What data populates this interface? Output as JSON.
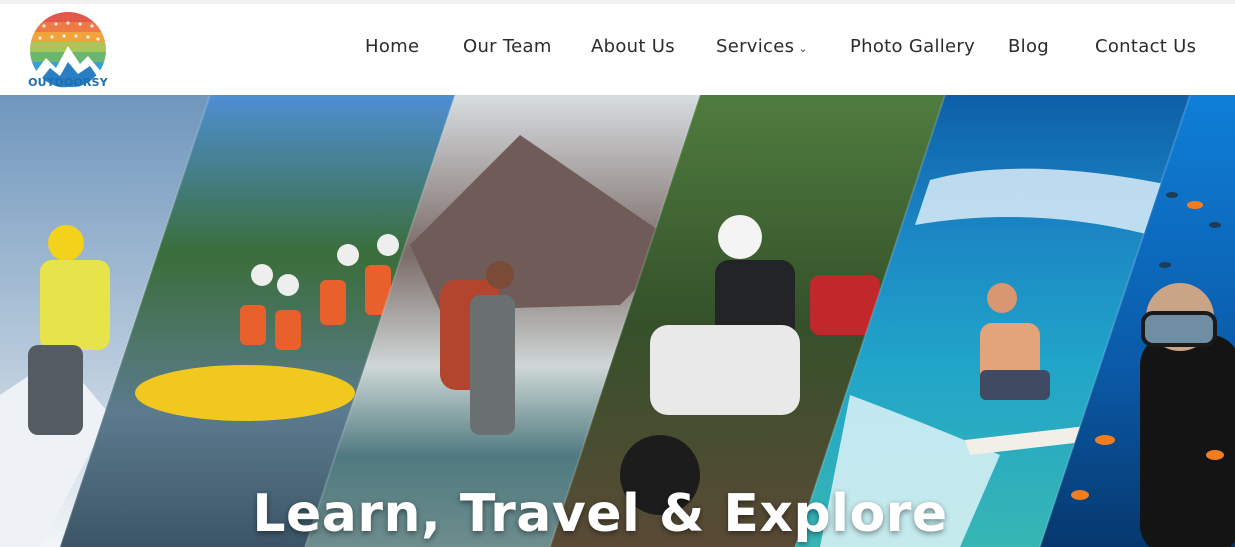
{
  "brand": {
    "name": "OUTDOORSY",
    "logo_colors": [
      "#e4574b",
      "#f0a33c",
      "#6bb66e",
      "#3c9ed6"
    ]
  },
  "nav": {
    "items": [
      {
        "label": "Home"
      },
      {
        "label": "Our Team"
      },
      {
        "label": "About Us"
      },
      {
        "label": "Services",
        "has_dropdown": true
      },
      {
        "label": "Photo Gallery"
      },
      {
        "label": "Blog"
      },
      {
        "label": "Contact Us"
      }
    ],
    "dropdown_icon": "chevron-down-icon"
  },
  "hero": {
    "title": "Learn, Travel & Explore",
    "panels": [
      "skiing",
      "rafting",
      "hiking",
      "motorbiking",
      "surfing",
      "scuba-diving"
    ]
  }
}
